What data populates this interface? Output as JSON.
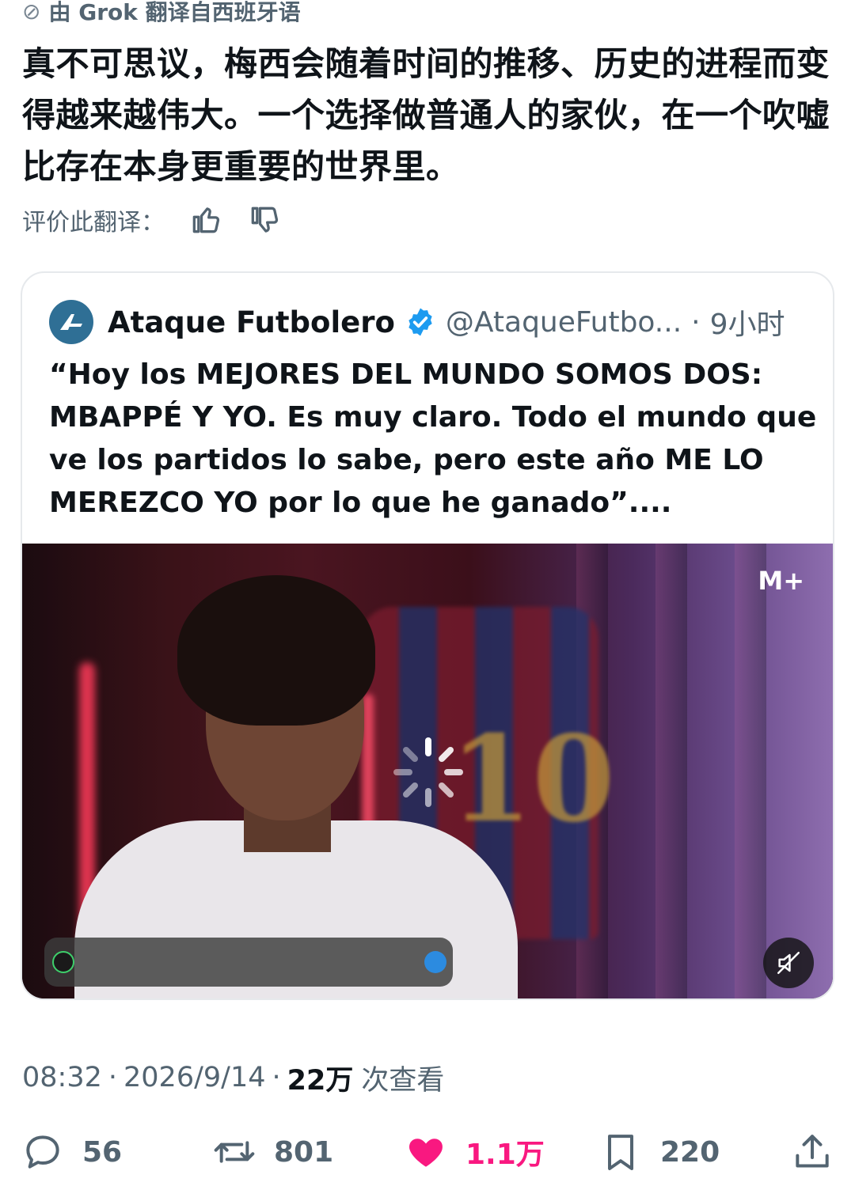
{
  "translation": {
    "header": "由 Grok 翻译自西班牙语",
    "text": "真不可思议，梅西会随着时间的推移、历史的进程而变得越来越伟大。一个选择做普通人的家伙，在一个吹嘘比存在本身更重要的世界里。",
    "rate_label": "评价此翻译："
  },
  "quote": {
    "name": "Ataque Futbolero",
    "handle": "@AtaqueFutbo...",
    "separator": "·",
    "time": "9小时",
    "text": "“Hoy los MEJORES DEL MUNDO SOMOS DOS: MBAPPÉ Y YO. Es muy claro. Todo el mundo que ve los partidos lo sabe, pero este año ME LO MEREZCO YO por lo que he ganado”....",
    "media": {
      "watermark": "M+",
      "jersey_number": "10",
      "state": "loading",
      "muted": true
    }
  },
  "meta": {
    "time": "08:32",
    "date": "2026/9/14",
    "views": "22万",
    "views_label": "次查看"
  },
  "actions": {
    "replies": "56",
    "retweets": "801",
    "likes": "1.1万",
    "bookmarks": "220"
  },
  "colors": {
    "like_active": "#f91880",
    "verified": "#1d9bf0",
    "secondary_text": "#536471"
  }
}
